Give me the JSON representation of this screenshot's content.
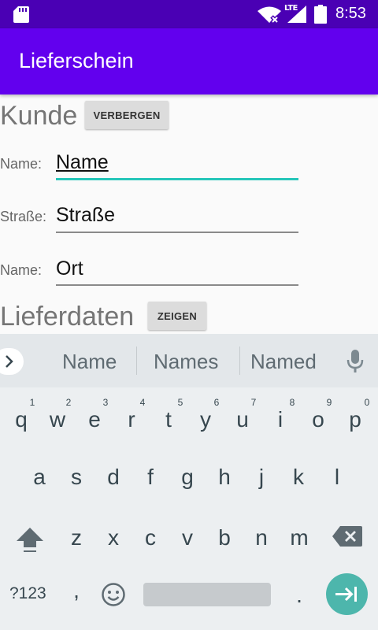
{
  "status_bar": {
    "lte": "LTE",
    "time": "8:53",
    "icons": [
      "sd-card-icon",
      "wifi-icon",
      "signal-icon",
      "battery-icon"
    ]
  },
  "app_bar": {
    "title": "Lieferschein",
    "color": "#6200ee"
  },
  "customer": {
    "title": "Kunde",
    "toggle_label": "VERBERGEN",
    "fields": [
      {
        "label": "Name:",
        "value": "Name",
        "active": true
      },
      {
        "label": "Straße:",
        "value": "Straße",
        "active": false
      },
      {
        "label": "Name:",
        "value": "Ort",
        "active": false
      }
    ]
  },
  "delivery": {
    "title": "Lieferdaten",
    "toggle_label": "ZEIGEN"
  },
  "keyboard": {
    "suggestions": [
      "Name",
      "Names",
      "Named"
    ],
    "row1": [
      "q",
      "w",
      "e",
      "r",
      "t",
      "y",
      "u",
      "i",
      "o",
      "p"
    ],
    "row1_hints": [
      "1",
      "2",
      "3",
      "4",
      "5",
      "6",
      "7",
      "8",
      "9",
      "0"
    ],
    "row2": [
      "a",
      "s",
      "d",
      "f",
      "g",
      "h",
      "j",
      "k",
      "l"
    ],
    "row3": [
      "z",
      "x",
      "c",
      "v",
      "b",
      "n",
      "m"
    ],
    "symbols_label": "?123",
    "comma": ",",
    "period": ".",
    "accent": "#4db6ac"
  }
}
